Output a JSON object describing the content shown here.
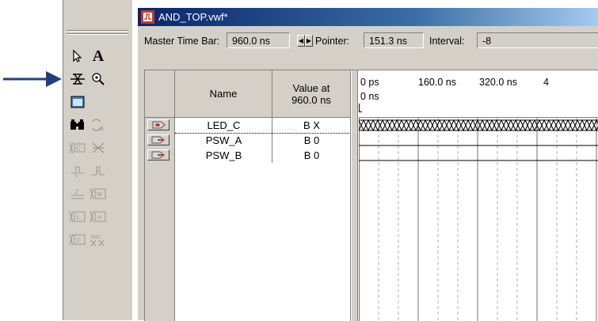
{
  "window": {
    "title": "AND_TOP.vwf*"
  },
  "toolbar": {
    "tools": [
      {
        "name": "selection-tool-icon",
        "glyph": "↖"
      },
      {
        "name": "text-tool-icon",
        "glyph": "A"
      },
      {
        "name": "waveform-editing-tool-icon",
        "glyph": "⌘"
      },
      {
        "name": "zoom-tool-icon",
        "glyph": "⊕"
      },
      {
        "name": "fullscreen-icon",
        "glyph": "▣"
      },
      {
        "name": "find-icon",
        "glyph": "🔍"
      },
      {
        "name": "replace-icon",
        "glyph": "⇄"
      }
    ]
  },
  "timebar": {
    "master_label": "Master Time Bar:",
    "master_value": "960.0 ns",
    "pointer_label": "Pointer:",
    "pointer_value": "151.3 ns",
    "interval_label": "Interval:",
    "interval_value": "-8"
  },
  "table": {
    "headers": {
      "name": "Name",
      "value_line1": "Value at",
      "value_line2": "960.0 ns"
    },
    "rows": [
      {
        "name": "LED_C",
        "value": "B X",
        "type": "output"
      },
      {
        "name": "PSW_A",
        "value": "B 0",
        "type": "input"
      },
      {
        "name": "PSW_B",
        "value": "B 0",
        "type": "input"
      }
    ]
  },
  "waveform": {
    "ticks": [
      "0 ps",
      "160.0 ns",
      "320.0 ns",
      "4"
    ],
    "cursor_label": "0 ns"
  },
  "colors": {
    "title_bar": "#0a246a",
    "annotation_arrow": "#1f3f7f",
    "panel_bg": "#d4d0c8"
  }
}
